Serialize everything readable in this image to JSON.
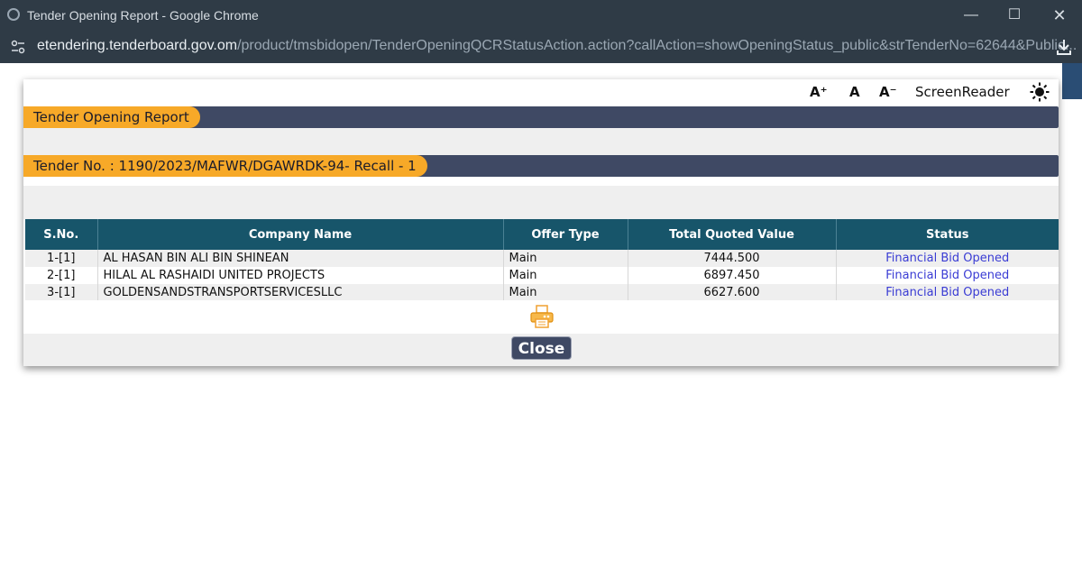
{
  "window": {
    "title": "Tender Opening Report - Google Chrome",
    "url_host": "etendering.tenderboard.gov.om",
    "url_path": "/product/tmsbidopen/TenderOpeningQCRStatusAction.action?callAction=showOpeningStatus_public&strTenderNo=62644&Public..."
  },
  "toolbar": {
    "font_increase": "A⁺",
    "font_normal": "A",
    "font_decrease": "A⁻",
    "screen_reader": "ScreenReader"
  },
  "report": {
    "heading": "Tender Opening Report",
    "tender_label": "Tender No.  :  1190/2023/MAFWR/DGAWRDK-94- Recall - 1"
  },
  "table": {
    "headers": [
      "S.No.",
      "Company Name",
      "Offer Type",
      "Total Quoted Value",
      "Status"
    ],
    "rows": [
      [
        "1-[1]",
        "AL HASAN BIN ALI BIN SHINEAN",
        "Main",
        "7444.500",
        "Financial Bid Opened"
      ],
      [
        "2-[1]",
        "HILAL AL RASHAIDI UNITED PROJECTS",
        "Main",
        "6897.450",
        "Financial Bid Opened"
      ],
      [
        "3-[1]",
        "GOLDENSANDSTRANSPORTSERVICESLLC",
        "Main",
        "6627.600",
        "Financial Bid Opened"
      ]
    ]
  },
  "actions": {
    "close_label": "Close"
  },
  "colors": {
    "title_bar": "#2f3b46",
    "accent_orange": "#f7a928",
    "header_bar": "#3f4964",
    "table_header": "#17556a",
    "status_link": "#3a3cd4"
  },
  "icons": [
    "app-icon",
    "site-settings-icon",
    "download-icon",
    "sun-icon",
    "printer-icon"
  ]
}
